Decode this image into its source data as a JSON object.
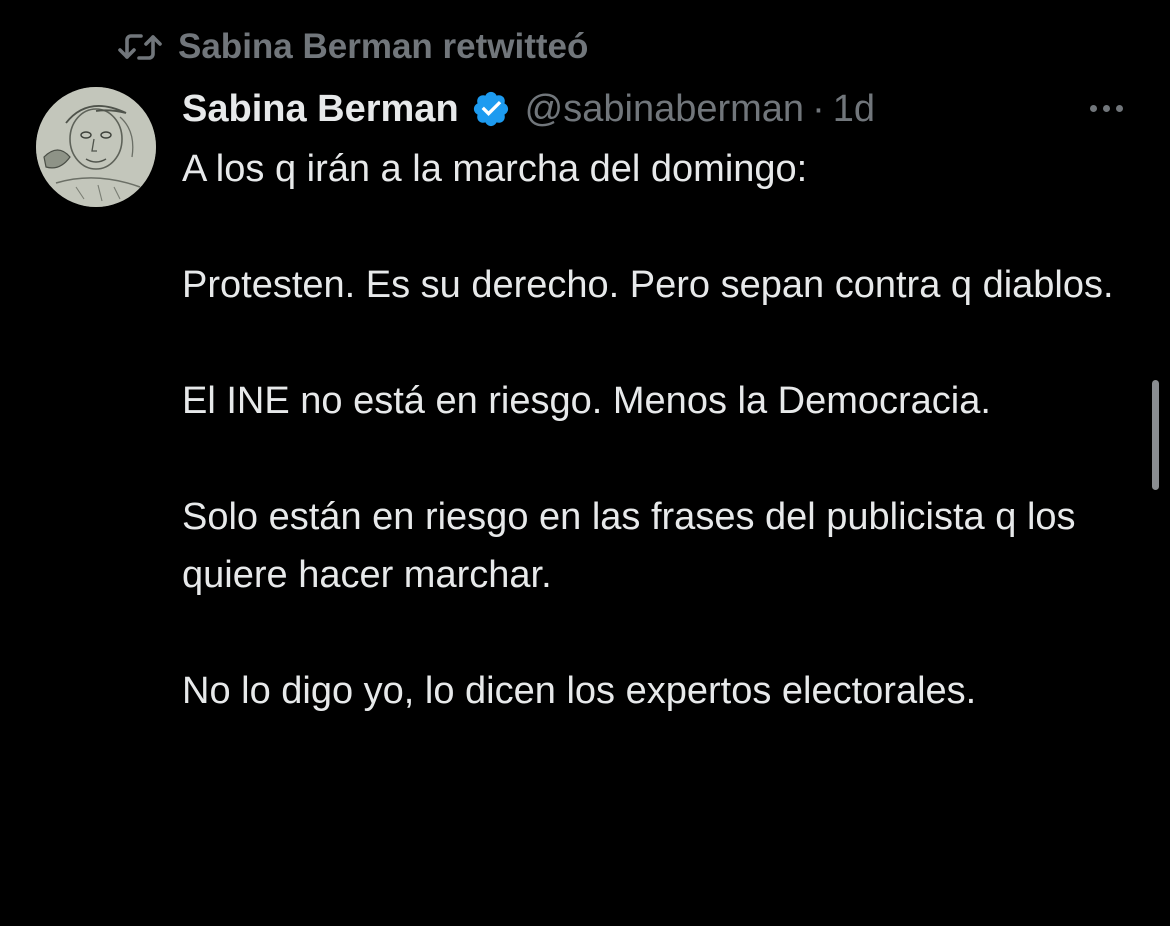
{
  "colors": {
    "background": "#000000",
    "primary_text": "#e7e9ea",
    "secondary_text": "#71767b",
    "verified_badge": "#1d9bf0"
  },
  "retweet": {
    "icon": "retweet-icon",
    "label": "Sabina Berman retwitteó"
  },
  "tweet": {
    "author_name": "Sabina Berman",
    "verified_icon": "verified-badge-icon",
    "handle": "@sabinaberman",
    "separator": "·",
    "time": "1d",
    "more_icon": "more-horizontal-icon",
    "paragraphs": [
      "A los q irán a la marcha del domingo:",
      "Protesten. Es su derecho. Pero sepan contra q diablos.",
      "El INE no está en riesgo. Menos la Democracia.",
      "Solo están en riesgo en las frases del publicista q los quiere hacer marchar.",
      "No lo digo yo, lo dicen los expertos electorales."
    ]
  }
}
